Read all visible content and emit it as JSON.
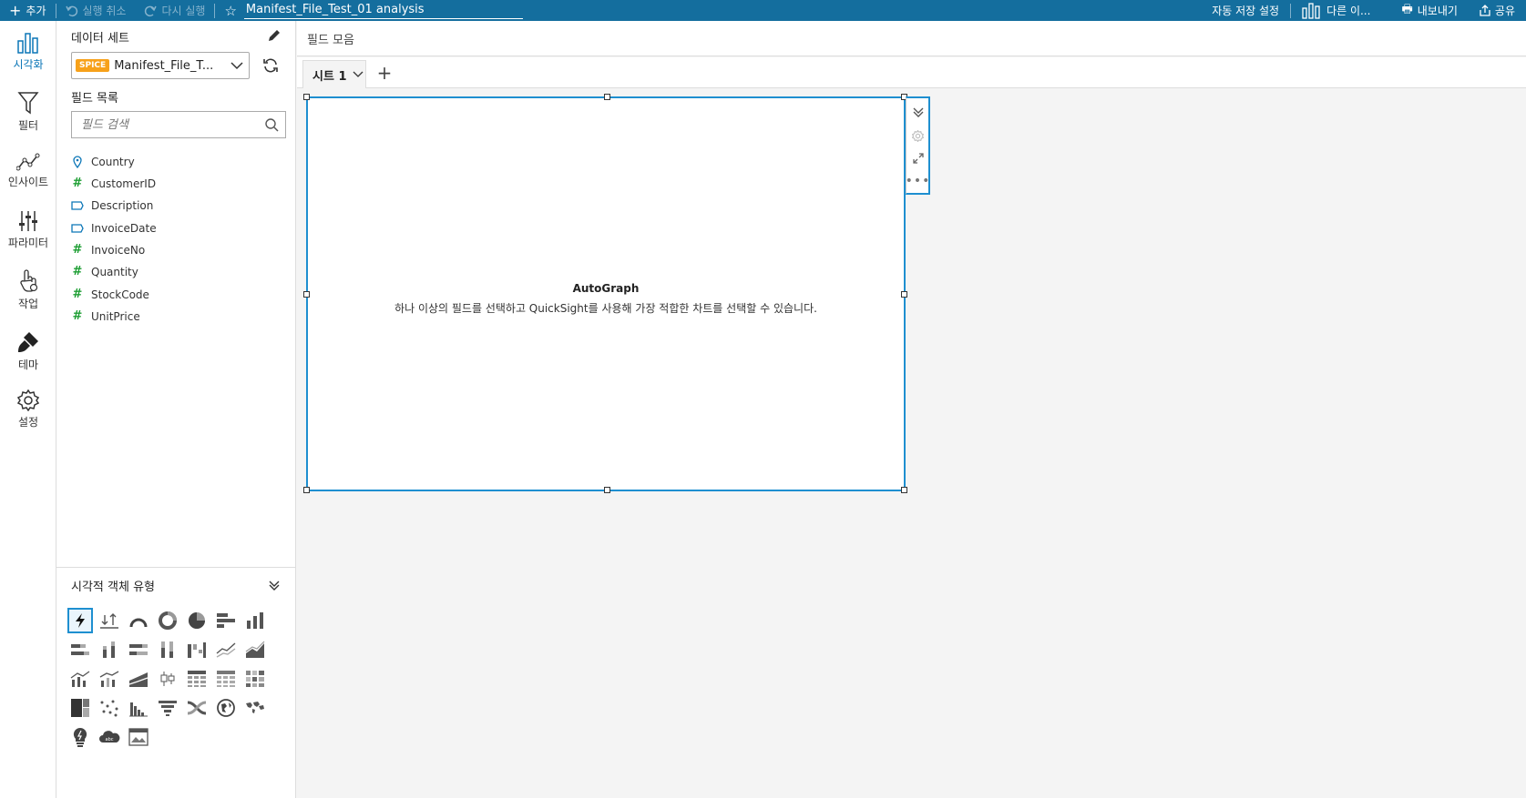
{
  "topbar": {
    "add_label": "추가",
    "undo_label": "실행 취소",
    "redo_label": "다시 실행",
    "analysis_title": "Manifest_File_Test_01 analysis",
    "autosave_label": "자동 저장 설정",
    "other_label": "다른 이...",
    "export_label": "내보내기",
    "share_label": "공유"
  },
  "rail": {
    "items": [
      {
        "label": "시각화",
        "icon": "visualize-icon",
        "active": true
      },
      {
        "label": "필터",
        "icon": "filter-icon"
      },
      {
        "label": "인사이트",
        "icon": "insights-icon"
      },
      {
        "label": "파라미터",
        "icon": "parameters-icon"
      },
      {
        "label": "작업",
        "icon": "actions-icon"
      },
      {
        "label": "테마",
        "icon": "themes-icon"
      },
      {
        "label": "설정",
        "icon": "settings-icon"
      }
    ]
  },
  "panel": {
    "dataset_label": "데이터 세트",
    "spice_badge": "SPICE",
    "dataset_name": "Manifest_File_T...",
    "field_list_label": "필드 목록",
    "search_placeholder": "필드 검색",
    "fields": [
      {
        "name": "Country",
        "type": "geo"
      },
      {
        "name": "CustomerID",
        "type": "measure"
      },
      {
        "name": "Description",
        "type": "dimension"
      },
      {
        "name": "InvoiceDate",
        "type": "dimension"
      },
      {
        "name": "InvoiceNo",
        "type": "measure"
      },
      {
        "name": "Quantity",
        "type": "measure"
      },
      {
        "name": "StockCode",
        "type": "measure"
      },
      {
        "name": "UnitPrice",
        "type": "measure"
      }
    ],
    "visual_types_label": "시각적 객체 유형"
  },
  "main": {
    "field_wells_label": "필드 모음",
    "sheet_tab_label": "시트 1",
    "visual_title": "AutoGraph",
    "visual_text": "하나 이상의 필드를 선택하고 QuickSight를 사용해 가장 적합한 차트를 선택할 수 있습니다."
  },
  "colors": {
    "topbar": "#146e9e",
    "accent": "#1e8fd0",
    "measure": "#1d9e33",
    "spice": "#f7a11a"
  }
}
